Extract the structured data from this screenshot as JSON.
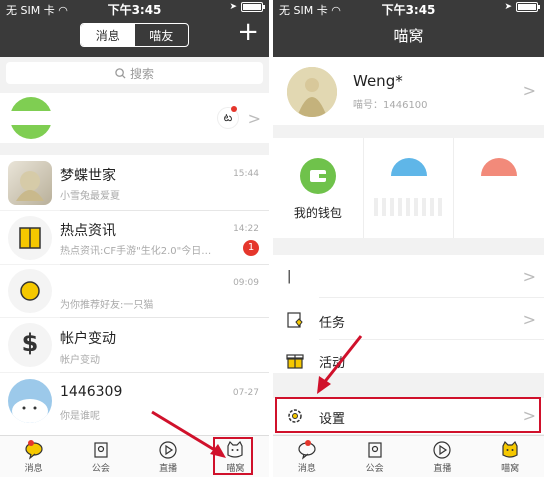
{
  "status": {
    "carrier": "无 SIM 卡",
    "time": "下午3:45"
  },
  "left": {
    "seg_tabs": [
      "消息",
      "喵友"
    ],
    "search_placeholder": "搜索",
    "top_row_chev": ">",
    "messages": [
      {
        "title": "梦蝶世家",
        "sub": "小雪兔最爱夏",
        "time": "15:44"
      },
      {
        "title": "热点资讯",
        "sub": "热点资讯:CF手游\"生化2.0\"今日…",
        "time": "14:22",
        "badge": "1"
      },
      {
        "title": "",
        "sub": "为你推荐好友:一只猫",
        "time": "09:09"
      },
      {
        "title": "帐户变动",
        "sub": "帐户变动",
        "time": ""
      },
      {
        "title": "1446309",
        "sub": "你是谁呢",
        "time": "07-27"
      }
    ],
    "tabs": [
      "消息",
      "公会",
      "直播",
      "喵窝"
    ]
  },
  "right": {
    "title": "喵窝",
    "profile": {
      "name": "Weng*",
      "id": "喵号：1446100"
    },
    "wallet_label": "我的钱包",
    "menu": [
      {
        "label": "|"
      },
      {
        "label": "任务"
      },
      {
        "label": "活动"
      },
      {
        "label": "设置"
      }
    ],
    "tabs": [
      "消息",
      "公会",
      "直播",
      "喵窝"
    ]
  },
  "colors": {
    "header": "#3a3a3a",
    "accent": "#f5c800",
    "highlight": "#d0112b",
    "badge": "#e5362c"
  }
}
